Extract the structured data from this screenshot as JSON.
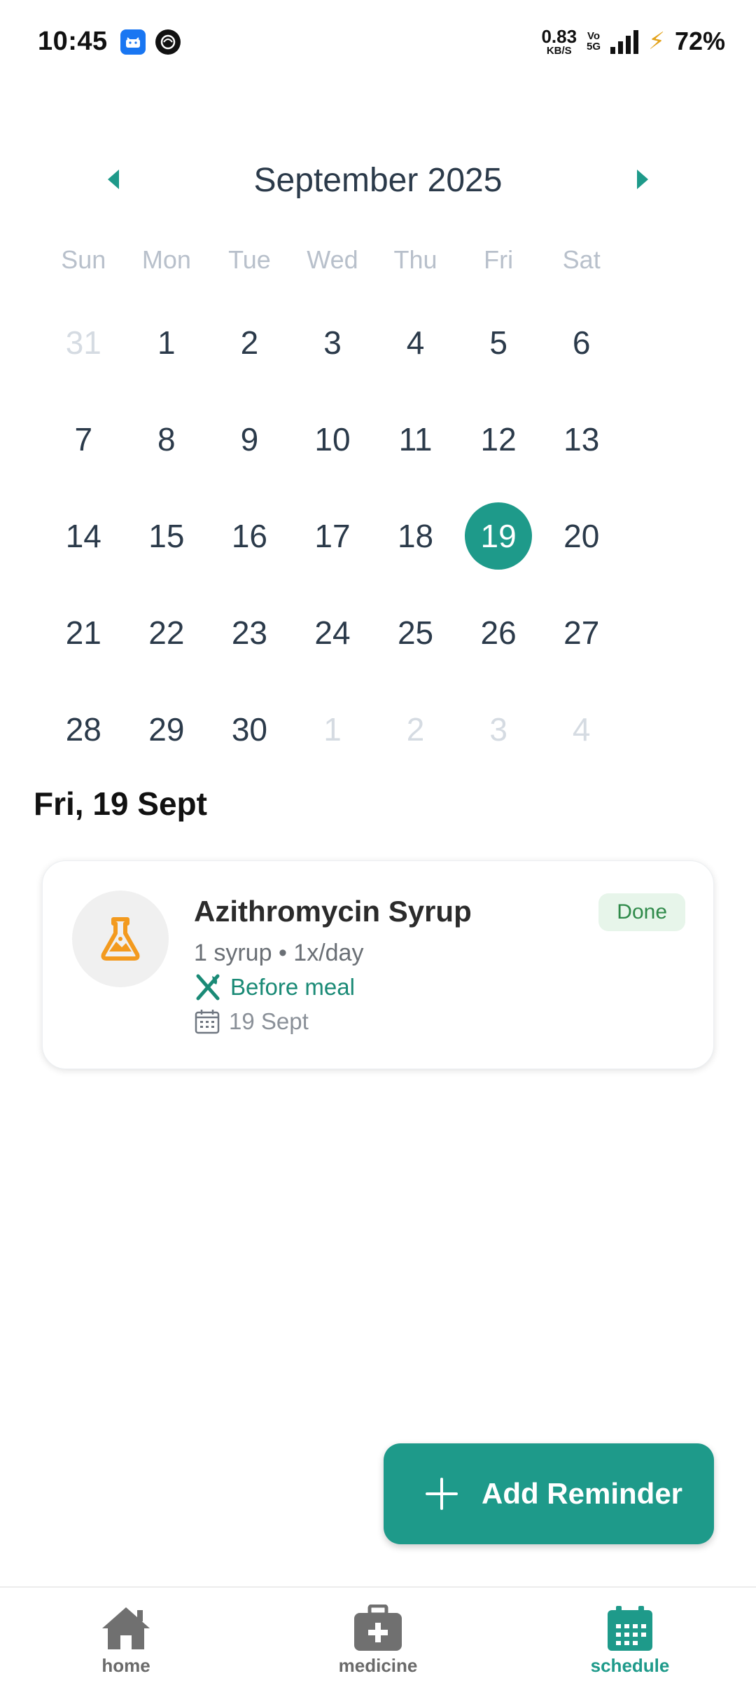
{
  "status_bar": {
    "time": "10:45",
    "speed_value": "0.83",
    "speed_unit": "KB/S",
    "volte_top": "Vo",
    "volte_bottom": "5G",
    "network": "5G",
    "battery": "72%"
  },
  "calendar": {
    "month_title": "September 2025",
    "weekdays": [
      "Sun",
      "Mon",
      "Tue",
      "Wed",
      "Thu",
      "Fri",
      "Sat"
    ],
    "days": [
      {
        "label": "31",
        "muted": true
      },
      {
        "label": "1"
      },
      {
        "label": "2"
      },
      {
        "label": "3"
      },
      {
        "label": "4"
      },
      {
        "label": "5"
      },
      {
        "label": "6"
      },
      {
        "label": "7"
      },
      {
        "label": "8"
      },
      {
        "label": "9"
      },
      {
        "label": "10"
      },
      {
        "label": "11"
      },
      {
        "label": "12"
      },
      {
        "label": "13"
      },
      {
        "label": "14"
      },
      {
        "label": "15"
      },
      {
        "label": "16"
      },
      {
        "label": "17"
      },
      {
        "label": "18"
      },
      {
        "label": "19",
        "selected": true
      },
      {
        "label": "20"
      },
      {
        "label": "21"
      },
      {
        "label": "22"
      },
      {
        "label": "23"
      },
      {
        "label": "24"
      },
      {
        "label": "25"
      },
      {
        "label": "26"
      },
      {
        "label": "27"
      },
      {
        "label": "28"
      },
      {
        "label": "29"
      },
      {
        "label": "30"
      },
      {
        "label": "1",
        "muted": true
      },
      {
        "label": "2",
        "muted": true
      },
      {
        "label": "3",
        "muted": true
      },
      {
        "label": "4",
        "muted": true
      }
    ]
  },
  "selected_date_heading": "Fri, 19 Sept",
  "reminder": {
    "title": "Azithromycin Syrup",
    "dosage": "1 syrup • 1x/day",
    "meal": "Before meal",
    "date": "19 Sept",
    "status": "Done",
    "icon": "flask-icon"
  },
  "fab": {
    "label": "Add Reminder"
  },
  "bottom_nav": {
    "home": "home",
    "medicine": "medicine",
    "schedule": "schedule"
  },
  "colors": {
    "accent": "#1e9a8a",
    "selected_day_bg": "#1e9a8a",
    "muted_day": "#d5dbe2",
    "meal_text": "#1a8a76",
    "badge_bg": "#e7f5ea",
    "badge_text": "#2f8a4a",
    "flask_icon": "#f39a1e"
  }
}
